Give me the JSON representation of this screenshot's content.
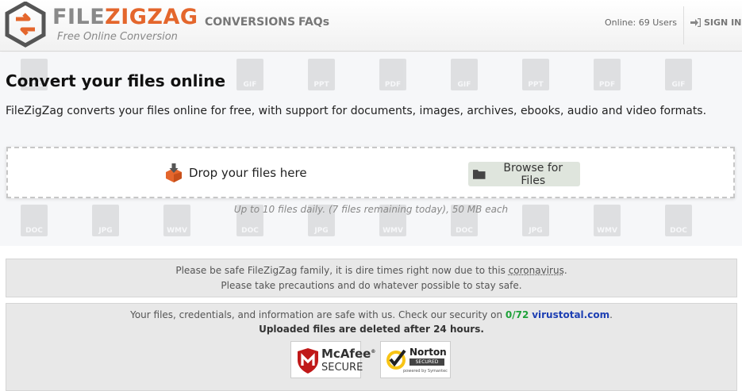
{
  "header": {
    "logo": {
      "word1": "FILE",
      "word2": "ZIGZAG",
      "tagline": "Free Online Conversion"
    },
    "nav": [
      {
        "label": "CONVERSIONS"
      },
      {
        "label": "FAQs"
      }
    ],
    "online_users": "Online: 69 Users",
    "signin_label": "SIGN IN"
  },
  "hero": {
    "title": "Convert your files online",
    "description": "FileZigZag converts your files online for free, with support for documents, images, archives, ebooks, audio and video formats.",
    "watermark_labels": [
      "DOC",
      "GIF",
      "PPT",
      "PDF",
      "GIF",
      "PPT",
      "PDF",
      "GIF",
      "JPG",
      "WMV",
      "DOC",
      "JPG",
      "WMV",
      "DOC",
      "JPG",
      "WMV",
      "DOC"
    ]
  },
  "dropzone": {
    "drop_label": "Drop your files here",
    "browse_label": "Browse for Files",
    "limits": "Up to 10 files daily. (7 files remaining today), 50 MB each"
  },
  "notice": {
    "line1_prefix": "Please be safe FileZigZag family, it is dire times right now due to this ",
    "line1_link": "coronavirus",
    "line1_suffix": ".",
    "line2": "Please take precautions and do whatever possible to stay safe."
  },
  "security": {
    "line1_prefix": "Your files, credentials, and information are safe with us. Check our security on ",
    "score": "0/72",
    "link": "virustotal.com",
    "line1_suffix": ".",
    "line2": "Uploaded files are deleted after 24 hours.",
    "mcafee": {
      "name": "McAfee",
      "reg": "®",
      "sub": "SECURE"
    },
    "norton": {
      "name": "Norton",
      "sub": "SECURED",
      "powered": "powered by Symantec"
    }
  },
  "colors": {
    "brand_orange": "#e4662c",
    "brand_gray": "#8a8a8a",
    "score_green": "#1fa23a",
    "link_blue": "#1d3fb3"
  }
}
